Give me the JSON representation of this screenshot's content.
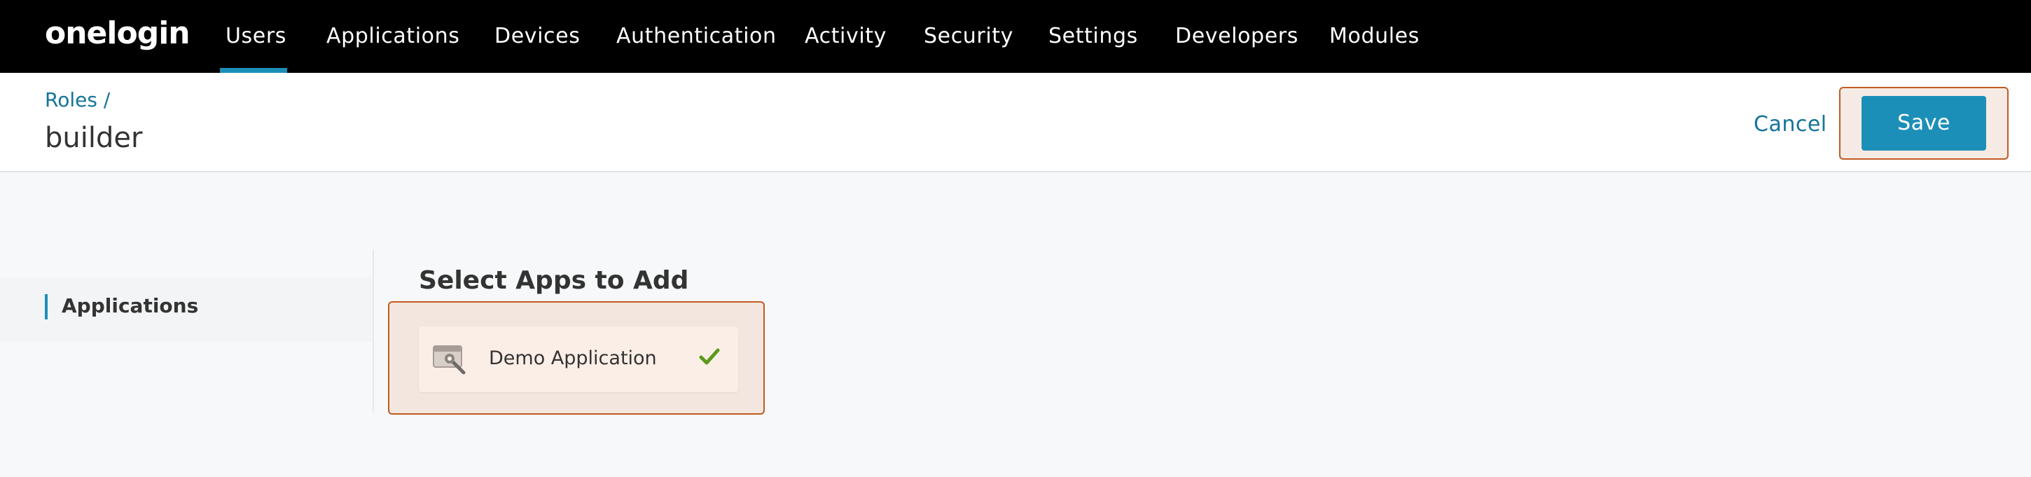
{
  "brand": {
    "logo_text": "onelogin"
  },
  "nav": {
    "items": [
      {
        "label": "Users"
      },
      {
        "label": "Applications"
      },
      {
        "label": "Devices"
      },
      {
        "label": "Authentication"
      },
      {
        "label": "Activity"
      },
      {
        "label": "Security"
      },
      {
        "label": "Settings"
      },
      {
        "label": "Developers"
      },
      {
        "label": "Modules"
      }
    ],
    "active": "Users"
  },
  "header": {
    "breadcrumb": "Roles /",
    "title": "builder",
    "cancel_label": "Cancel",
    "save_label": "Save"
  },
  "sidebar": {
    "items": [
      {
        "label": "Applications",
        "active": true
      }
    ]
  },
  "content": {
    "section_title": "Select Apps to Add",
    "apps": [
      {
        "name": "Demo Application",
        "icon": "app-wrench-icon",
        "selected": true,
        "status_icon": "checkmark-icon"
      }
    ]
  },
  "colors": {
    "nav_background": "#000000",
    "accent": "#1c8fb8",
    "link": "#14749a",
    "highlight_border": "#c15a22",
    "check_green": "#5a9b1a"
  }
}
